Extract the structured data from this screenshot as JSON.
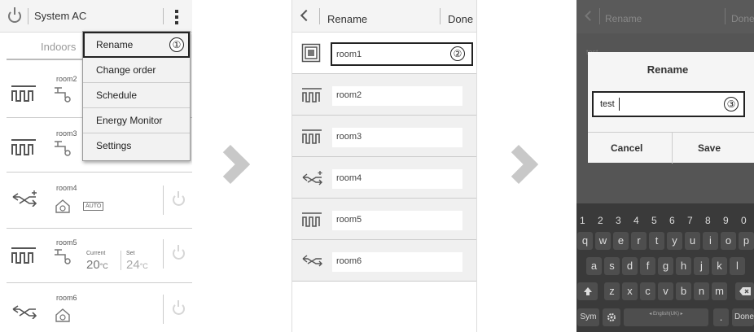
{
  "panel1": {
    "title": "System AC",
    "tab_label": "Indoors",
    "menu": {
      "items": [
        "Rename",
        "Change order",
        "Schedule",
        "Energy Monitor",
        "Settings"
      ],
      "callout": "①"
    },
    "rows": [
      {
        "name": "room2",
        "icon": "heater-icon"
      },
      {
        "name": "room3",
        "icon": "heater-icon"
      },
      {
        "name": "room4",
        "icon": "ventilation-icon",
        "mode": "AUTO"
      },
      {
        "name": "room5",
        "icon": "heater-icon",
        "current_label": "Current",
        "current_temp": "20",
        "set_label": "Set",
        "set_temp": "24",
        "unit": "°C"
      },
      {
        "name": "room6",
        "icon": "ventilation-icon"
      }
    ]
  },
  "panel2": {
    "title": "Rename",
    "done_label": "Done",
    "callout": "②",
    "rows": [
      {
        "name": "room1",
        "icon": "square-device-icon"
      },
      {
        "name": "room2",
        "icon": "heater-icon"
      },
      {
        "name": "room3",
        "icon": "heater-icon"
      },
      {
        "name": "room4",
        "icon": "ventilation-icon"
      },
      {
        "name": "room5",
        "icon": "heater-icon"
      },
      {
        "name": "room6",
        "icon": "ventilation-icon"
      }
    ]
  },
  "panel3": {
    "title": "Rename",
    "done_label": "Done",
    "ghost_text": "test",
    "dialog": {
      "title": "Rename",
      "input_value": "test",
      "callout": "③",
      "cancel_label": "Cancel",
      "save_label": "Save"
    },
    "keyboard": {
      "numbers": [
        "1",
        "2",
        "3",
        "4",
        "5",
        "6",
        "7",
        "8",
        "9",
        "0"
      ],
      "row1": [
        "q",
        "w",
        "e",
        "r",
        "t",
        "y",
        "u",
        "i",
        "o",
        "p"
      ],
      "row2": [
        "a",
        "s",
        "d",
        "f",
        "g",
        "h",
        "j",
        "k",
        "l"
      ],
      "row3": [
        "z",
        "x",
        "c",
        "v",
        "b",
        "n",
        "m"
      ],
      "sym_label": "Sym",
      "lang_label": "English(UK)",
      "period_label": ".",
      "done_label": "Done"
    }
  },
  "colors": {
    "background": "#ffffff",
    "divider": "#cccccc",
    "arrow": "#c8c8c8",
    "keyboard": "#3a3a3a"
  }
}
